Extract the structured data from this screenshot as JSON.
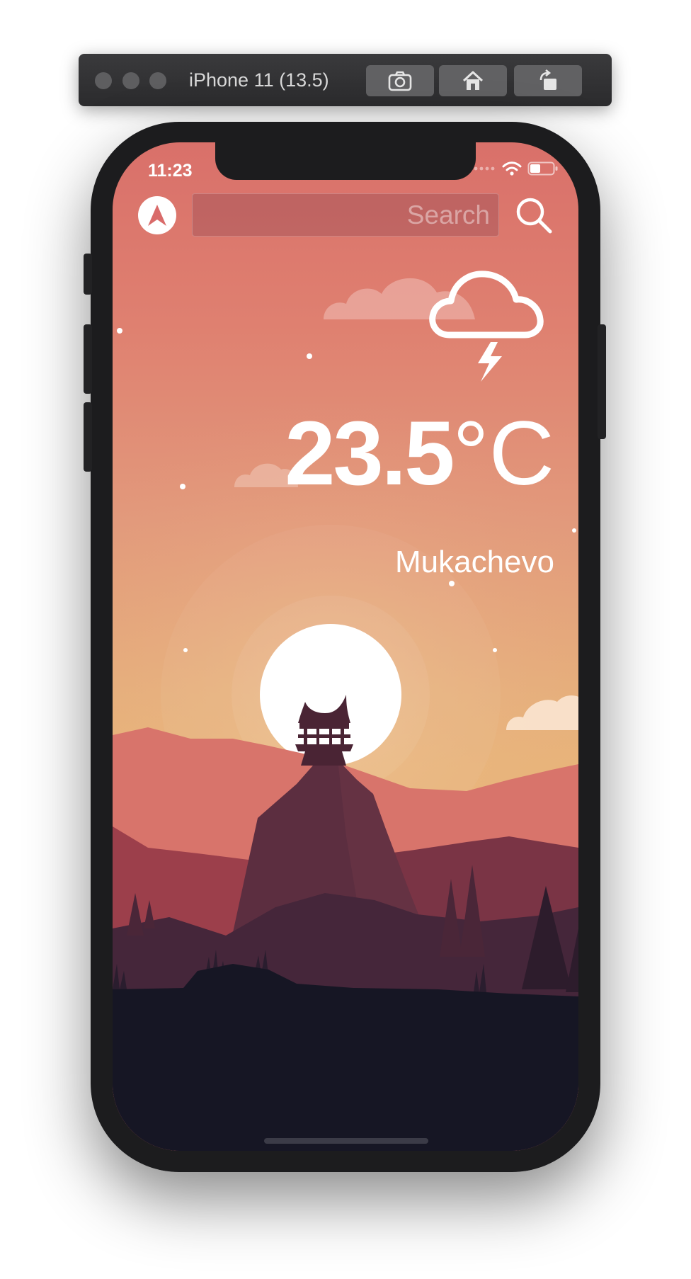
{
  "simulator": {
    "title": "iPhone 11 (13.5)",
    "buttons": [
      "screenshot-icon",
      "home-icon",
      "rotate-icon"
    ]
  },
  "status_bar": {
    "time": "11:23",
    "icons": [
      "signal-dots-icon",
      "wifi-icon",
      "battery-icon"
    ]
  },
  "header": {
    "nav_icon": "navigation-arrow-icon",
    "search_placeholder": "Search",
    "search_icon": "magnifier-icon"
  },
  "weather": {
    "condition_icon": "thunderstorm-cloud-icon",
    "temperature_value": "23.5",
    "temperature_unit": "°C",
    "city": "Mukachevo"
  },
  "colors": {
    "sky_top": "#d9706a",
    "sky_bottom": "#e8b57a",
    "sun": "#ffffff",
    "mountain_dark": "#5a2e3f",
    "ground": "#161624"
  }
}
